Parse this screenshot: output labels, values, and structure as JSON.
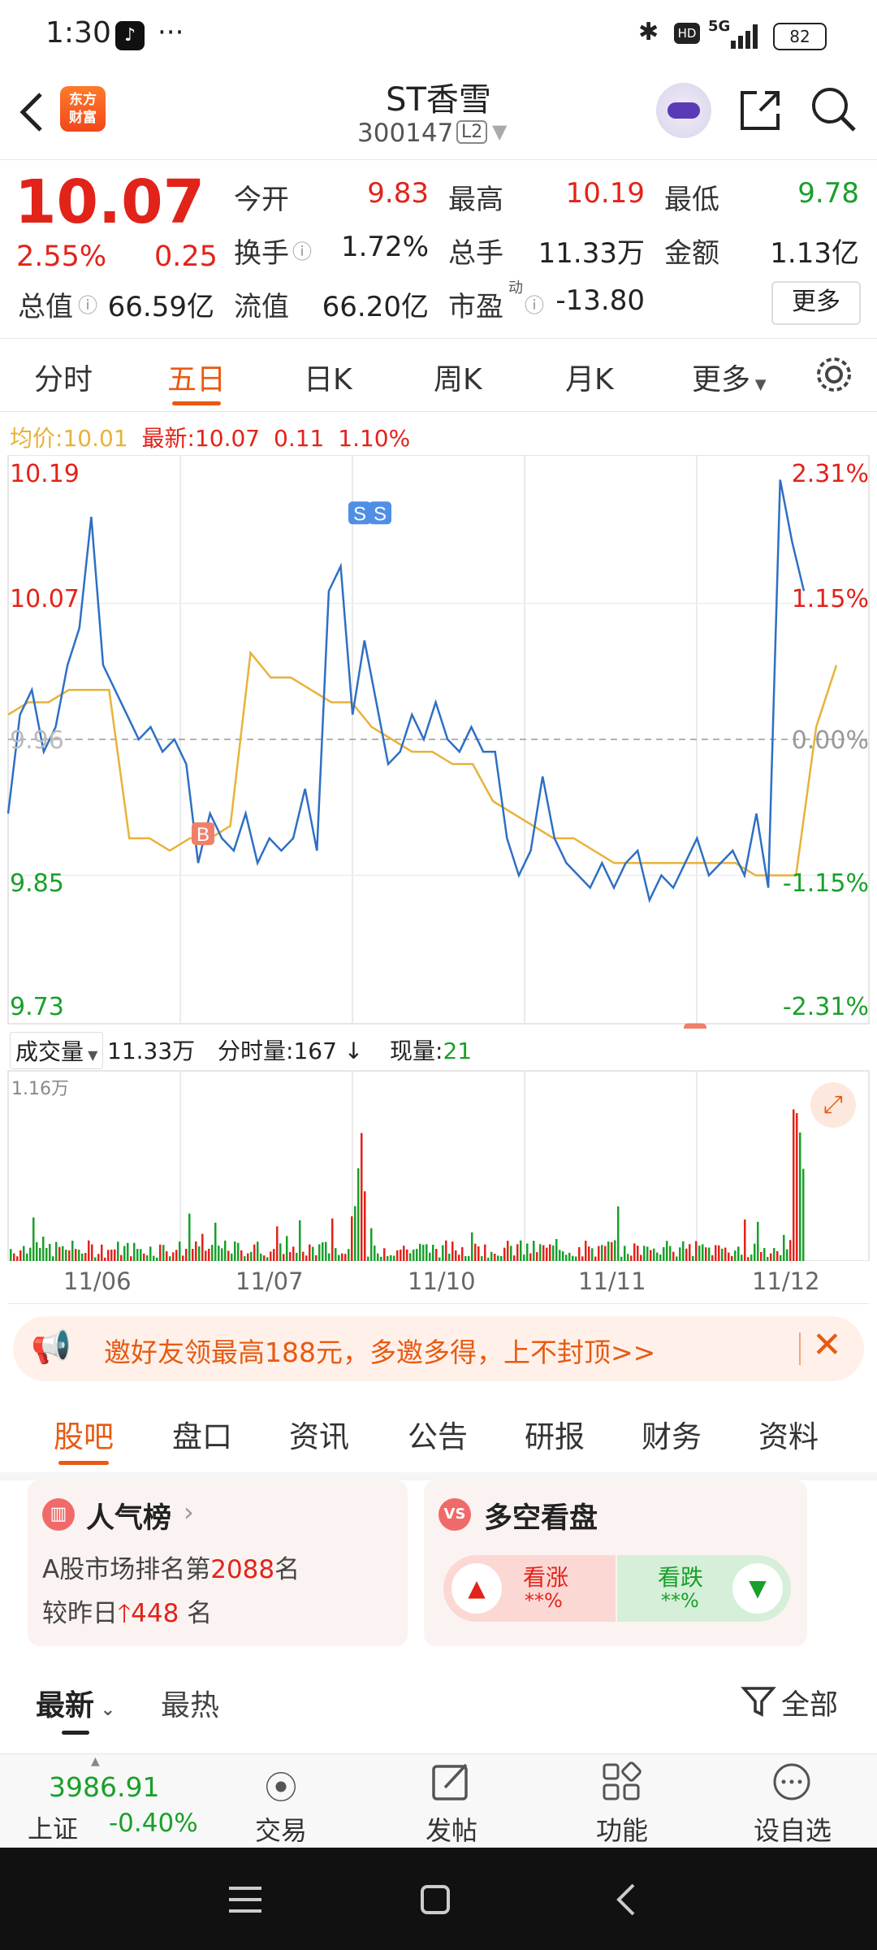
{
  "status": {
    "time": "1:30",
    "dots": "···",
    "network": "5G",
    "battery": "82"
  },
  "header": {
    "logo_line1": "东方",
    "logo_line2": "财富",
    "title": "ST香雪",
    "code": "300147",
    "level": "L2"
  },
  "quote": {
    "price": "10.07",
    "pct": "2.55%",
    "change": "0.25",
    "open_label": "今开",
    "open": "9.83",
    "high_label": "最高",
    "high": "10.19",
    "low_label": "最低",
    "low": "9.78",
    "turnover_label": "换手",
    "turnover": "1.72%",
    "volume_label": "总手",
    "volume": "11.33万",
    "amount_label": "金额",
    "amount": "1.13亿",
    "mktcap_label": "总值",
    "mktcap": "66.59亿",
    "float_label": "流值",
    "float": "66.20亿",
    "pe_label": "市盈",
    "pe_sup": "动",
    "pe": "-13.80",
    "more": "更多"
  },
  "tabs": [
    "分时",
    "五日",
    "日K",
    "周K",
    "月K",
    "更多"
  ],
  "chart_info": {
    "avg_label": "均价:",
    "avg": "10.01",
    "latest_label": "最新:",
    "latest": "10.07",
    "chg": "0.11",
    "chg_pct": "1.10%"
  },
  "chart_data": {
    "type": "line",
    "title": "",
    "x_labels": [
      "11/06",
      "11/07",
      "11/10",
      "11/11",
      "11/12"
    ],
    "y_ticks": [
      "10.19",
      "10.07",
      "9.96",
      "9.85",
      "9.73"
    ],
    "pct_ticks": [
      "2.31%",
      "1.15%",
      "0.00%",
      "-1.15%",
      "-2.31%"
    ],
    "ylim": [
      9.73,
      10.19
    ],
    "series": [],
    "price": [
      9.9,
      9.98,
      10.0,
      9.95,
      9.97,
      10.02,
      10.05,
      10.14,
      10.02,
      10.0,
      9.98,
      9.96,
      9.97,
      9.95,
      9.96,
      9.94,
      9.86,
      9.9,
      9.88,
      9.87,
      9.9,
      9.86,
      9.88,
      9.87,
      9.88,
      9.92,
      9.87,
      10.08,
      10.1,
      9.98,
      10.04,
      9.99,
      9.94,
      9.95,
      9.98,
      9.96,
      9.99,
      9.96,
      9.95,
      9.97,
      9.95,
      9.95,
      9.88,
      9.85,
      9.87,
      9.93,
      9.88,
      9.86,
      9.85,
      9.84,
      9.86,
      9.84,
      9.86,
      9.87,
      9.83,
      9.85,
      9.84,
      9.86,
      9.88,
      9.85,
      9.86,
      9.87,
      9.85,
      9.9,
      9.84,
      10.17,
      10.12,
      10.08
    ],
    "avg": [
      9.98,
      9.99,
      9.99,
      10.0,
      10.0,
      10.0,
      9.88,
      9.88,
      9.87,
      9.88,
      9.88,
      9.89,
      10.03,
      10.01,
      10.01,
      10.0,
      9.99,
      9.99,
      9.97,
      9.96,
      9.95,
      9.95,
      9.94,
      9.94,
      9.91,
      9.9,
      9.89,
      9.88,
      9.88,
      9.87,
      9.86,
      9.86,
      9.86,
      9.86,
      9.86,
      9.86,
      9.86,
      9.85,
      9.85,
      9.85,
      9.97,
      10.02
    ],
    "volume_label": "成交量",
    "volume_total": "11.33万",
    "interval_label": "分时量:",
    "interval": "167",
    "now_label": "现量:",
    "now": "21",
    "vol_max": "1.16万",
    "markers": [
      "B",
      "S",
      "S",
      "B",
      "S"
    ]
  },
  "banner": {
    "text": "邀好友领最高188元，多邀多得，上不封顶>>"
  },
  "section_tabs": [
    "股吧",
    "盘口",
    "资讯",
    "公告",
    "研报",
    "财务",
    "资料"
  ],
  "popularity": {
    "title": "人气榜",
    "line1_prefix": "A股市场排名第",
    "rank": "2088",
    "line1_suffix": "名",
    "line2_prefix": "较昨日",
    "delta": "448",
    "line2_suffix": "名"
  },
  "sentiment": {
    "title": "多空看盘",
    "bull": "看涨",
    "bull_pct": "**%",
    "bear": "看跌",
    "bear_pct": "**%",
    "badge": "VS"
  },
  "feed": {
    "latest": "最新",
    "hot": "最热",
    "all": "全部"
  },
  "bottom_nav": {
    "index_value": "3986.91",
    "index_name": "上证",
    "index_pct": "-0.40%",
    "trade": "交易",
    "post": "发帖",
    "func": "功能",
    "watch": "设自选"
  },
  "colors": {
    "up": "#e2231a",
    "down": "#19a02a",
    "accent": "#e85a12",
    "line": "#2f6fc4",
    "avg": "#e8b23a"
  }
}
